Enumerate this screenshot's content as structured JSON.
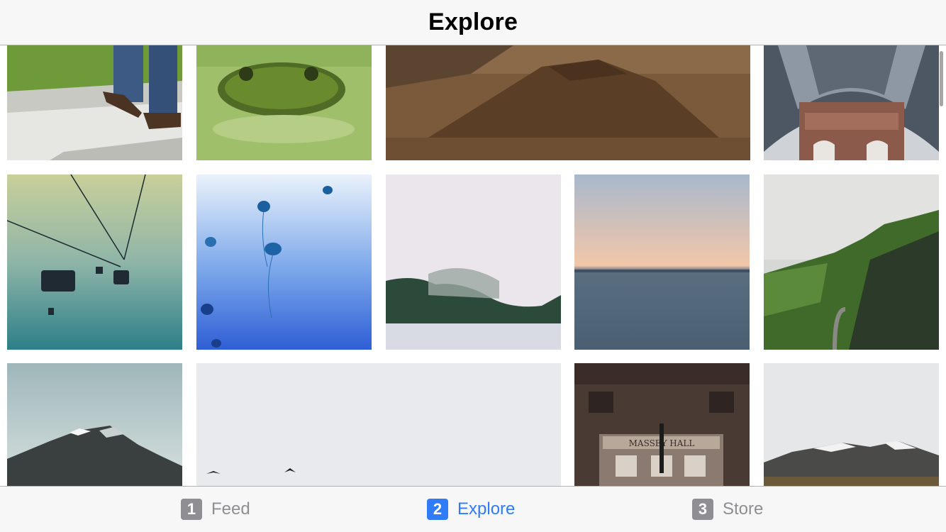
{
  "nav": {
    "title": "Explore"
  },
  "tabs": [
    {
      "number": "1",
      "label": "Feed",
      "selected": false
    },
    {
      "number": "2",
      "label": "Explore",
      "selected": true
    },
    {
      "number": "3",
      "label": "Store",
      "selected": false
    }
  ],
  "colors": {
    "accent": "#2f7cf6",
    "inactive": "#8e8e93",
    "inactive_badge": "#8e8e93",
    "bar_background": "#f7f7f7"
  },
  "photos": [
    {
      "name": "walking-person-photo"
    },
    {
      "name": "frog-in-duckweed-photo"
    },
    {
      "name": "volcano-photo"
    },
    {
      "name": "domed-building-photo"
    },
    {
      "name": "cable-car-photo"
    },
    {
      "name": "jellyfish-photo"
    },
    {
      "name": "misty-lake-photo"
    },
    {
      "name": "sea-horizon-photo"
    },
    {
      "name": "green-cliffs-photo"
    },
    {
      "name": "snowy-mountain-photo"
    },
    {
      "name": "birds-in-fog-photo"
    },
    {
      "name": "massey-hall-photo",
      "sign_text": "MASSEY HALL"
    },
    {
      "name": "cloudy-peaks-photo"
    }
  ]
}
